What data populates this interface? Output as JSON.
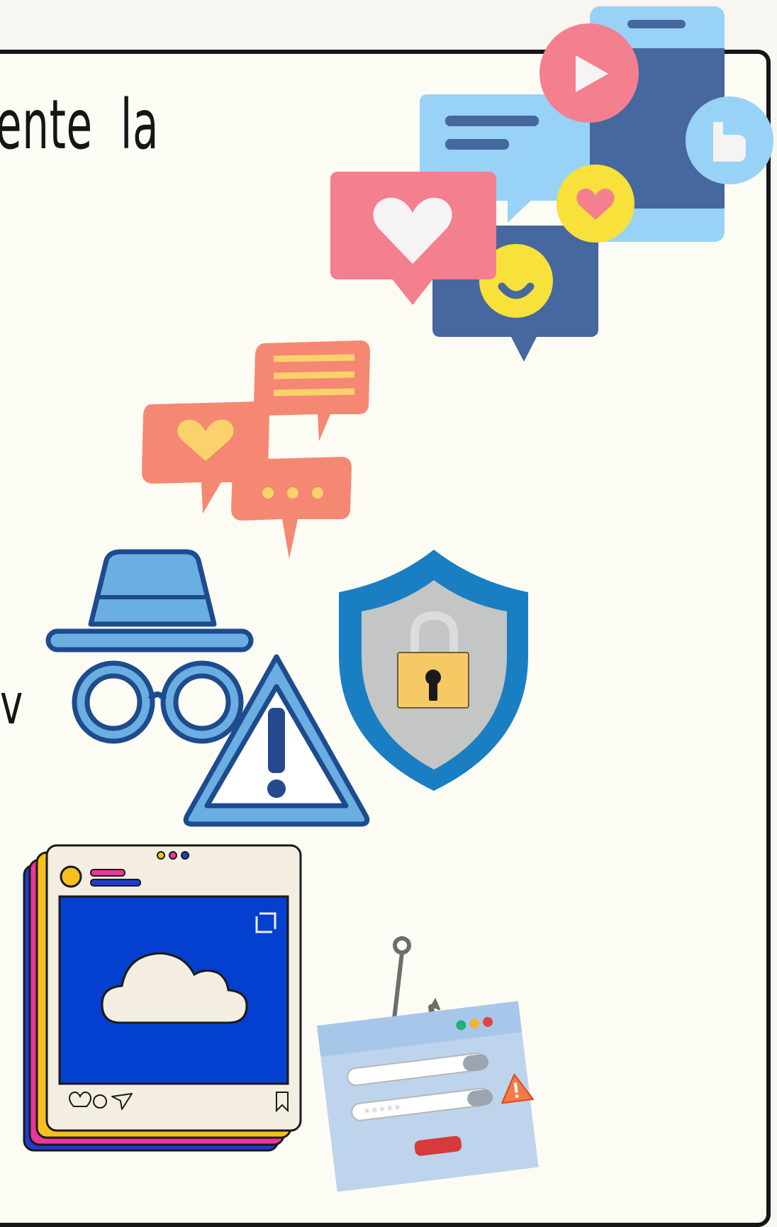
{
  "content": {
    "heading_fragment": "ente  la",
    "side_fragment": "v"
  },
  "post_card": {
    "dots_label": "•••"
  },
  "login_card": {
    "password_mask": "*****"
  },
  "colors": {
    "page_bg": "#f8f6f1",
    "panel_bg": "#fdfcf4",
    "border": "#161616",
    "pink": "#f47f8f",
    "light_blue": "#98d2f7",
    "navy": "#46689e",
    "yellow": "#f7e13a",
    "coral": "#f58872",
    "shield_blue": "#1a7ec2",
    "royal_blue": "#0340cf"
  },
  "icons": [
    "smartphone-icon",
    "play-icon",
    "like-icon",
    "heart-chat-icon",
    "smiley-chat-icon",
    "heart-badge-icon",
    "chat-bubbles-icon",
    "incognito-icon",
    "warning-icon",
    "shield-lock-icon",
    "social-post-icon",
    "phishing-hook-icon",
    "login-form-icon"
  ]
}
